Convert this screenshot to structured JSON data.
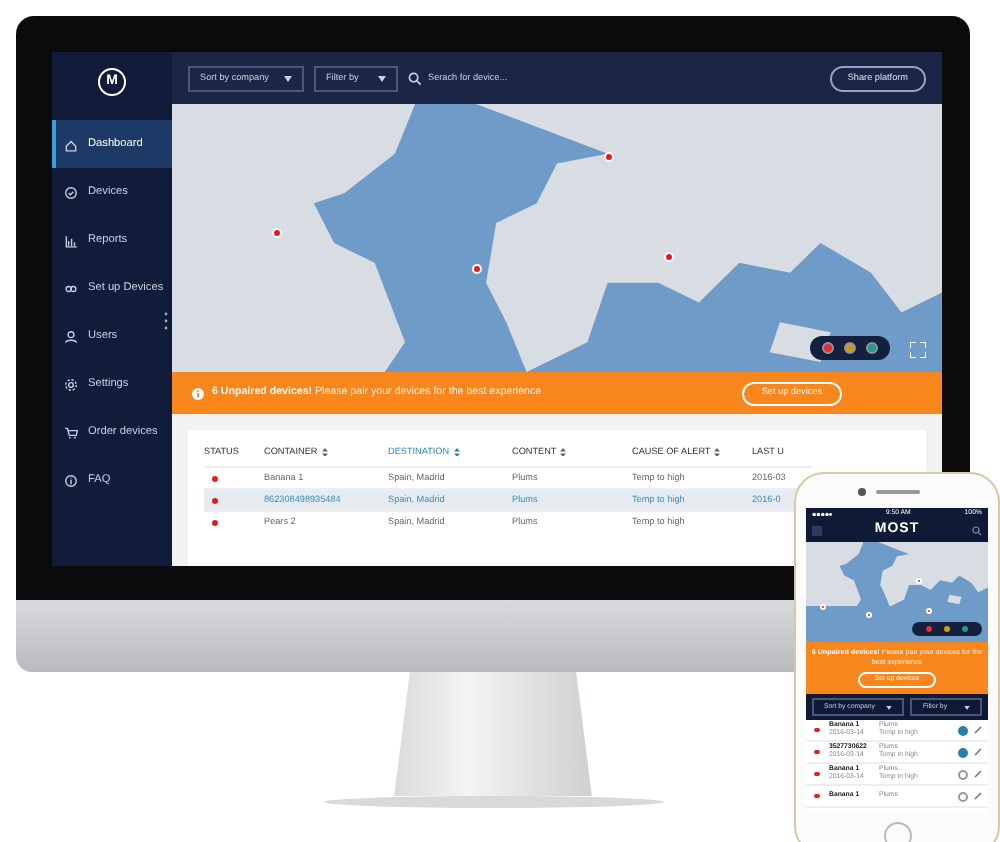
{
  "monitor": {
    "logo": "M",
    "toolbar": {
      "sort": "Sort by company",
      "filter": "Filter by",
      "search": {
        "placeholder": "Serach for device..."
      },
      "share": "Share platform"
    },
    "sidebar": {
      "items": [
        {
          "label": "Dashboard",
          "selected": true
        },
        {
          "label": "Devices",
          "selected": false
        },
        {
          "label": "Reports",
          "selected": false
        },
        {
          "label": "Set up Devices",
          "selected": false
        },
        {
          "label": "Users",
          "selected": false
        },
        {
          "label": "Settings",
          "selected": false
        },
        {
          "label": "Order devices",
          "selected": false
        },
        {
          "label": "FAQ",
          "selected": false
        }
      ]
    },
    "map": {
      "legend": [
        {
          "color": "#e02f2f"
        },
        {
          "color": "#c99a1e"
        },
        {
          "color": "#1f9b86"
        }
      ]
    },
    "banner": {
      "text": "**6 Unpaired devices!** Please pair your devices for the best experience",
      "button": "Set up devices"
    },
    "table": {
      "columns": [
        {
          "label": "STATUS",
          "sortable": false,
          "sorted": false
        },
        {
          "label": "CONTAINER",
          "sortable": true,
          "sorted": false
        },
        {
          "label": "DESTINATION",
          "sortable": true,
          "sorted": true
        },
        {
          "label": "CONTENT",
          "sortable": true,
          "sorted": false
        },
        {
          "label": "CAUSE OF ALERT",
          "sortable": true,
          "sorted": false
        },
        {
          "label": "LAST U",
          "sortable": false,
          "sorted": false
        }
      ],
      "rows": [
        {
          "selected": false,
          "cells": [
            "",
            "Banana 1",
            "Spain, Madrid",
            "Plums",
            "Temp to high",
            "2016-03"
          ]
        },
        {
          "selected": true,
          "cells": [
            "",
            "862308498935484",
            "Spain, Madrid",
            "Plums",
            "Temp to high",
            "2016-0"
          ]
        },
        {
          "selected": false,
          "cells": [
            "",
            "Pears 2",
            "Spain, Madrid",
            "Plums",
            "Temp to high",
            ""
          ]
        }
      ]
    }
  },
  "phone": {
    "time": "9:50 AM",
    "battery": "100%",
    "title": "MOST",
    "legend": [
      {
        "color": "#e02f2f"
      },
      {
        "color": "#c99a1e"
      },
      {
        "color": "#1f9b86"
      }
    ],
    "banner": {
      "text": "**6 Unpaired devices!** Please pair your devices for the best experience",
      "button": "Set up devices"
    },
    "sort": "Sort by company",
    "filter": "Filter by",
    "rows": [
      {
        "name": "Banana 1",
        "date": "2016-03-14",
        "content": "Plums",
        "cause": "Temp to high",
        "checked": true
      },
      {
        "name": "3527730622",
        "date": "2016-03-14",
        "content": "Plums",
        "cause": "Temp to high",
        "checked": true
      },
      {
        "name": "Banana 1",
        "date": "2016-03-14",
        "content": "Plums",
        "cause": "Temp to high",
        "checked": false
      },
      {
        "name": "Banana 1",
        "content": "Plums",
        "checked": false
      }
    ]
  }
}
